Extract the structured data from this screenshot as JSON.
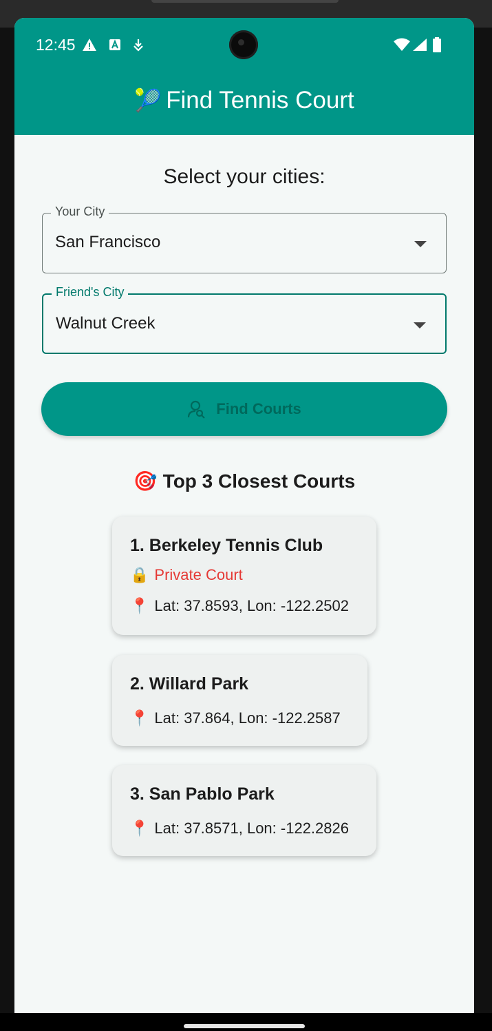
{
  "status_bar": {
    "time": "12:45",
    "icons_left": [
      "warning-icon",
      "a-badge-icon",
      "download-icon"
    ],
    "icons_right": [
      "wifi-icon",
      "signal-icon",
      "battery-icon"
    ]
  },
  "app_bar": {
    "emoji": "🎾",
    "title": "Find Tennis Court",
    "color": "#009688"
  },
  "form": {
    "heading": "Select your cities:",
    "your_city": {
      "label": "Your City",
      "value": "San Francisco"
    },
    "friends_city": {
      "label": "Friend's City",
      "value": "Walnut Creek"
    },
    "find_button": {
      "label": "Find Courts",
      "icon": "person-search-icon"
    }
  },
  "results": {
    "emoji": "🎯",
    "title": "Top 3 Closest Courts",
    "courts": [
      {
        "name": "1. Berkeley Tennis Club",
        "badge_emoji": "🔒",
        "badge": "Private Court",
        "pin": "📍",
        "coords": "Lat: 37.8593, Lon: -122.2502"
      },
      {
        "name": "2. Willard Park",
        "pin": "📍",
        "coords": "Lat: 37.864, Lon: -122.2587"
      },
      {
        "name": "3. San Pablo Park",
        "pin": "📍",
        "coords": "Lat: 37.8571, Lon: -122.2826"
      }
    ]
  },
  "colors": {
    "primary": "#009688",
    "focus": "#00796b",
    "private": "#e53935"
  }
}
